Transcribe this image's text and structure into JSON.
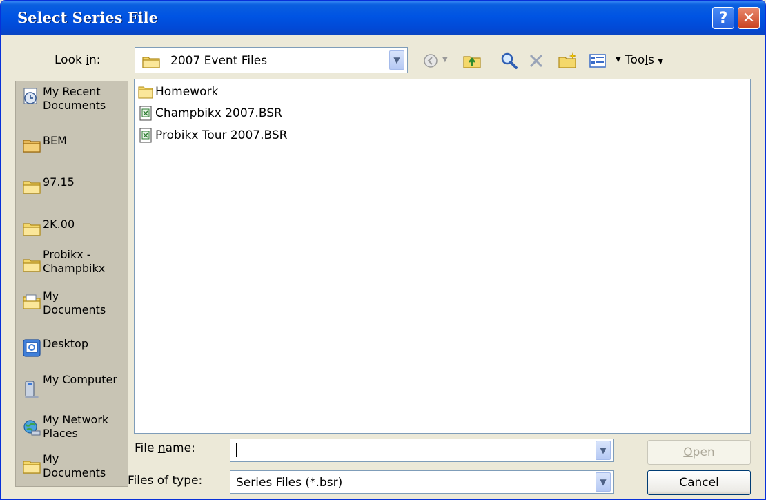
{
  "window": {
    "title": "Select Series File",
    "help_glyph": "?",
    "close_glyph": "✕"
  },
  "lookin": {
    "label_pre": "Look ",
    "label_accel": "i",
    "label_post": "n:",
    "value": "2007 Event Files"
  },
  "toolbar": {
    "tools_pre": "Too",
    "tools_accel": "l",
    "tools_post": "s"
  },
  "places": [
    {
      "label": "My Recent Documents",
      "icon": "recent-documents-icon"
    },
    {
      "label": "BEM",
      "icon": "folder-icon"
    },
    {
      "label": "97.15",
      "icon": "folder-icon"
    },
    {
      "label": "2K.00",
      "icon": "folder-icon"
    },
    {
      "label": "Probikx - Champbikx",
      "icon": "folder-icon"
    },
    {
      "label": "My Documents",
      "icon": "my-documents-icon"
    },
    {
      "label": "Desktop",
      "icon": "desktop-icon"
    },
    {
      "label": "My Computer",
      "icon": "computer-icon"
    },
    {
      "label": "My Network Places",
      "icon": "network-icon"
    },
    {
      "label": "My Documents",
      "icon": "folder-icon"
    }
  ],
  "files": [
    {
      "name": "Homework",
      "icon": "folder-icon"
    },
    {
      "name": "Champbikx 2007.BSR",
      "icon": "series-file-icon"
    },
    {
      "name": "Probikx Tour 2007.BSR",
      "icon": "series-file-icon"
    }
  ],
  "filename": {
    "label_pre": "File ",
    "label_accel": "n",
    "label_post": "ame:",
    "value": ""
  },
  "filetype": {
    "label_pre": "Files of ",
    "label_accel": "t",
    "label_post": "ype:",
    "value": "Series Files (*.bsr)"
  },
  "buttons": {
    "open_accel": "O",
    "open_rest": "pen",
    "cancel": "Cancel"
  }
}
